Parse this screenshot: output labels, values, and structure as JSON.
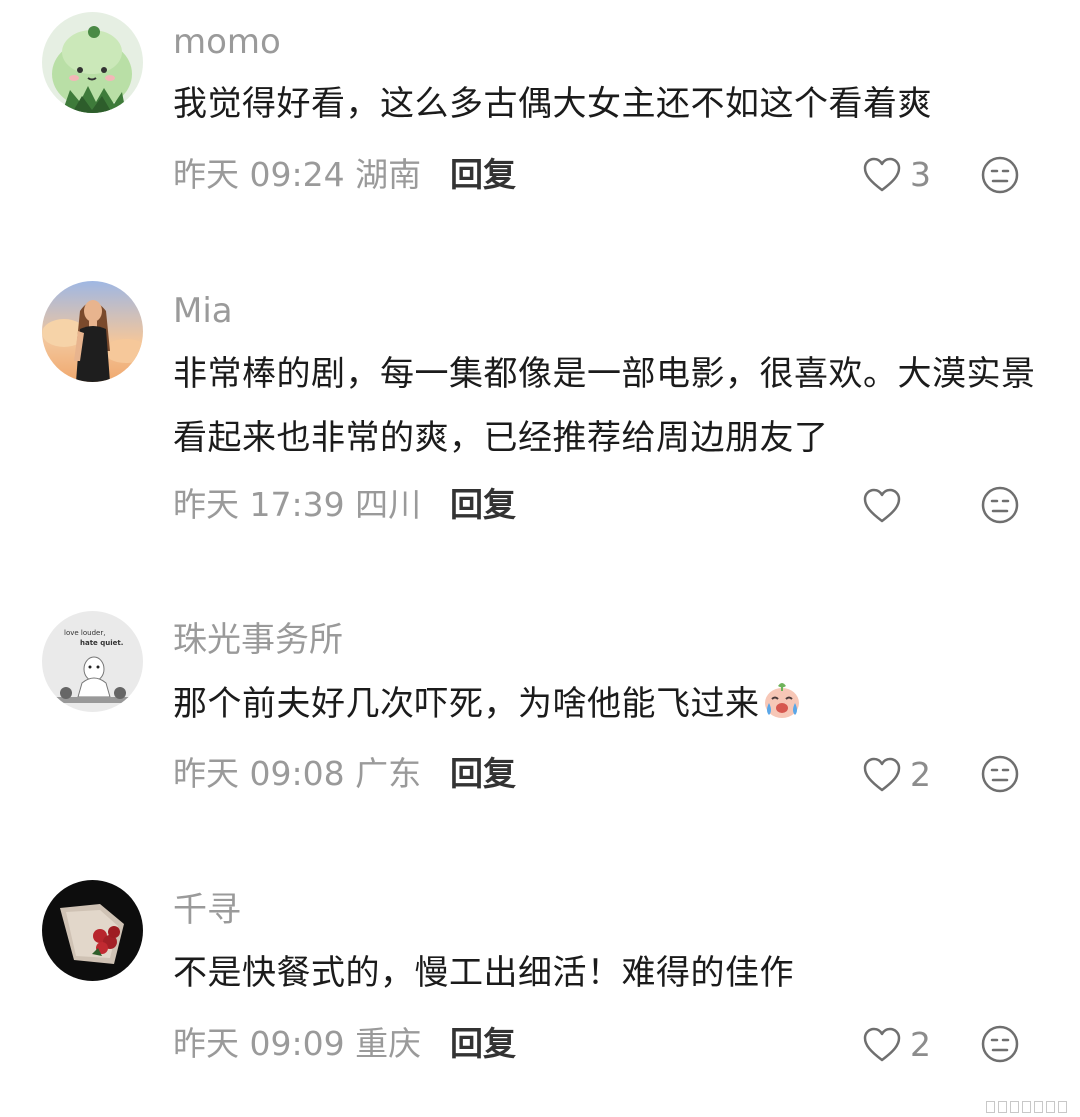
{
  "comments": [
    {
      "user": "momo",
      "text": "我觉得好看，这么多古偶大女主还不如这个看着爽",
      "meta": "昨天 09:24 湖南",
      "reply_label": "回复",
      "likes": "3"
    },
    {
      "user": "Mia",
      "text": "非常棒的剧，每一集都像是一部电影，很喜欢。大漠实景看起来也非常的爽，已经推荐给周边朋友了",
      "meta": "昨天 17:39 四川",
      "reply_label": "回复",
      "likes": ""
    },
    {
      "user": "珠光事务所",
      "text": "那个前夫好几次吓死，为啥他能飞过来",
      "meta": "昨天 09:08 广东",
      "reply_label": "回复",
      "likes": "2"
    },
    {
      "user": "千寻",
      "text": "不是快餐式的，慢工出细活！难得的佳作",
      "meta": "昨天 09:09 重庆",
      "reply_label": "回复",
      "likes": "2"
    }
  ],
  "avatar3_text": "love louder, hate quiet."
}
